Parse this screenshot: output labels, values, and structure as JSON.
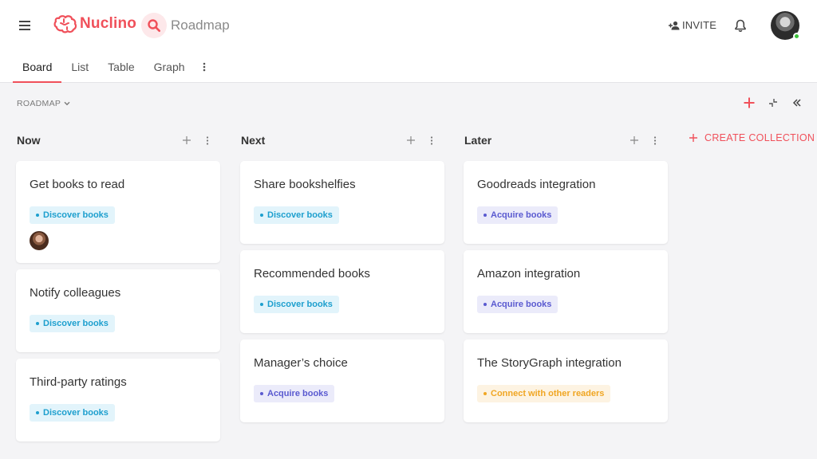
{
  "app": {
    "logo_text": "Nuclino",
    "workspace_name": "Roadmap",
    "invite_label": "INVITE",
    "brand_color": "#f0505a"
  },
  "tabs": [
    {
      "label": "Board",
      "active": true
    },
    {
      "label": "List",
      "active": false
    },
    {
      "label": "Table",
      "active": false
    },
    {
      "label": "Graph",
      "active": false
    }
  ],
  "breadcrumb": {
    "label": "ROADMAP"
  },
  "create_collection_label": "CREATE COLLECTION",
  "columns": [
    {
      "title": "Now",
      "cards": [
        {
          "title": "Get books to read",
          "tag": "Discover books",
          "tag_type": "discover",
          "has_avatar": true
        },
        {
          "title": "Notify colleagues",
          "tag": "Discover books",
          "tag_type": "discover"
        },
        {
          "title": "Third-party ratings",
          "tag": "Discover books",
          "tag_type": "discover"
        }
      ]
    },
    {
      "title": "Next",
      "cards": [
        {
          "title": "Share bookshelfies",
          "tag": "Discover books",
          "tag_type": "discover"
        },
        {
          "title": "Recommended books",
          "tag": "Discover books",
          "tag_type": "discover"
        },
        {
          "title": "Manager’s choice",
          "tag": "Acquire books",
          "tag_type": "acquire"
        }
      ]
    },
    {
      "title": "Later",
      "cards": [
        {
          "title": "Goodreads integration",
          "tag": "Acquire books",
          "tag_type": "acquire"
        },
        {
          "title": "Amazon integration",
          "tag": "Acquire books",
          "tag_type": "acquire"
        },
        {
          "title": "The StoryGraph integration",
          "tag": "Connect with other readers",
          "tag_type": "connect"
        }
      ]
    }
  ],
  "tag_colors": {
    "discover": "#1d9fce",
    "acquire": "#5a5ad0",
    "connect": "#f0a623"
  }
}
